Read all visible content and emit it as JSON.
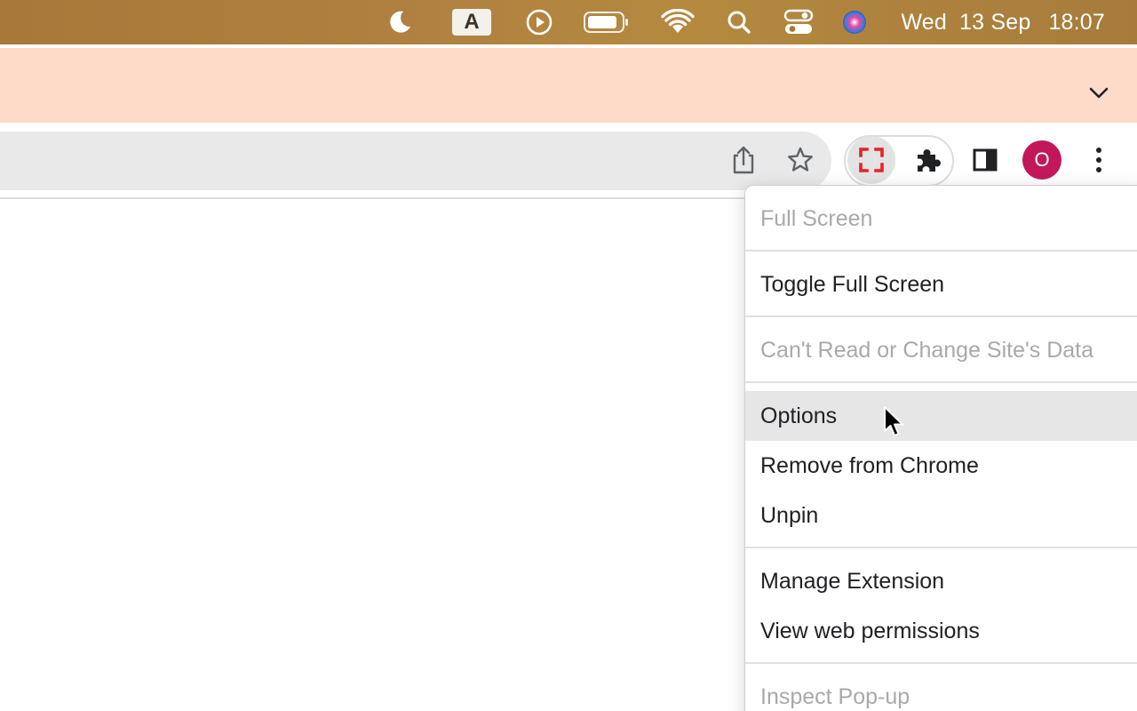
{
  "menubar": {
    "icons": [
      "moon-icon",
      "input-source-icon",
      "play-circle-icon",
      "battery-icon",
      "wifi-icon",
      "spotlight-search-icon",
      "control-center-icon",
      "siri-icon"
    ],
    "input_source_letter": "A",
    "clock": {
      "day": "Wed",
      "date": "13 Sep",
      "time": "18:07"
    }
  },
  "toolbar": {
    "icons": [
      "share-icon",
      "bookmark-star-icon",
      "fullscreen-extension-icon",
      "extensions-puzzle-icon",
      "side-panel-icon",
      "chrome-menu-icon"
    ],
    "profile_initial": "O",
    "profile_color": "#c2185b",
    "extension_accent": "#e8202a"
  },
  "context_menu": {
    "header": "Full Screen",
    "items": [
      {
        "label": "Toggle Full Screen",
        "disabled": false
      },
      {
        "label": "Can't Read or Change Site's Data",
        "disabled": true
      },
      {
        "label": "Options",
        "disabled": false,
        "hovered": true
      },
      {
        "label": "Remove from Chrome",
        "disabled": false
      },
      {
        "label": "Unpin",
        "disabled": false
      },
      {
        "label": "Manage Extension",
        "disabled": false
      },
      {
        "label": "View web permissions",
        "disabled": false
      },
      {
        "label": "Inspect Pop-up",
        "disabled": true
      }
    ]
  },
  "colors": {
    "tabstrip": "#fddbc8",
    "omnibox": "#e9e9ea",
    "hover_row": "#e6e6e6",
    "disabled_text": "#a9a9ab"
  }
}
